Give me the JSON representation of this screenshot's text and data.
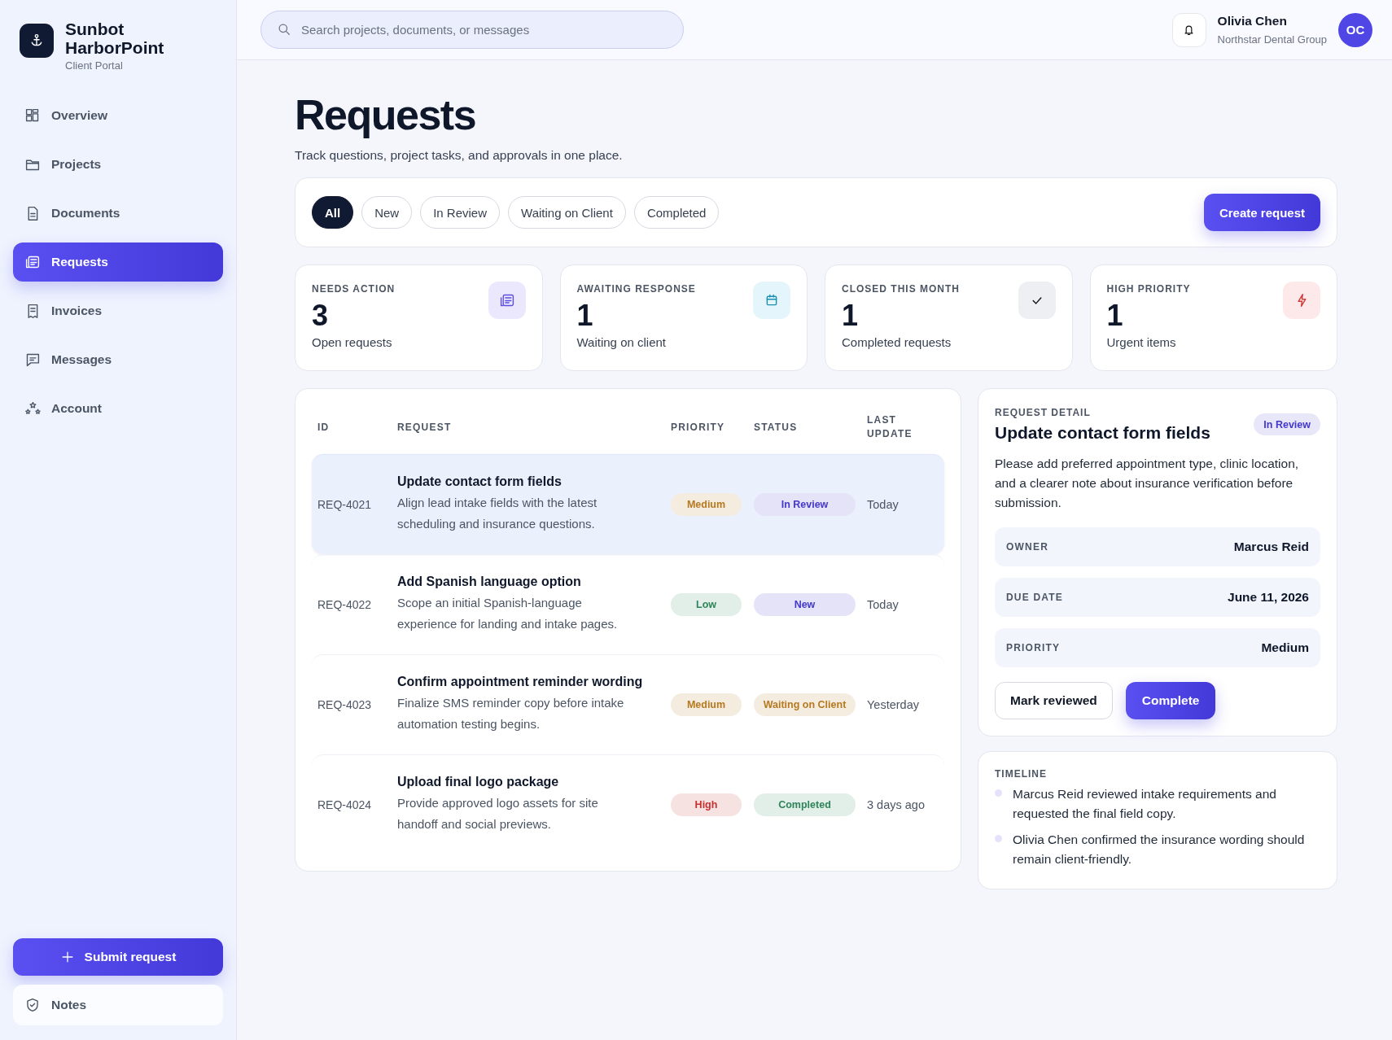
{
  "brand": {
    "name": "Sunbot HarborPoint",
    "subtitle": "Client Portal"
  },
  "nav": [
    {
      "label": "Overview",
      "selected": false
    },
    {
      "label": "Projects",
      "selected": false
    },
    {
      "label": "Documents",
      "selected": false
    },
    {
      "label": "Requests",
      "selected": true
    },
    {
      "label": "Invoices",
      "selected": false
    },
    {
      "label": "Messages",
      "selected": false
    },
    {
      "label": "Account",
      "selected": false
    }
  ],
  "sidebar_footer": {
    "submit_button": "Submit request",
    "notes": "Notes"
  },
  "search": {
    "placeholder": "Search projects, documents, or messages"
  },
  "user": {
    "name": "Olivia Chen",
    "organization": "Northstar Dental Group",
    "initials": "OC"
  },
  "page": {
    "title": "Requests",
    "subtitle": "Track questions, project tasks, and approvals in one place."
  },
  "filters": [
    {
      "label": "All",
      "selected": true
    },
    {
      "label": "New",
      "selected": false
    },
    {
      "label": "In Review",
      "selected": false
    },
    {
      "label": "Waiting on Client",
      "selected": false
    },
    {
      "label": "Completed",
      "selected": false
    }
  ],
  "create_button": "Create request",
  "stats": [
    {
      "label": "NEEDS ACTION",
      "value": "3",
      "caption": "Open requests"
    },
    {
      "label": "AWAITING RESPONSE",
      "value": "1",
      "caption": "Waiting on client"
    },
    {
      "label": "CLOSED THIS MONTH",
      "value": "1",
      "caption": "Completed requests"
    },
    {
      "label": "HIGH PRIORITY",
      "value": "1",
      "caption": "Urgent items"
    }
  ],
  "table": {
    "columns": [
      "ID",
      "REQUEST",
      "PRIORITY",
      "STATUS",
      "LAST UPDATE"
    ],
    "rows": [
      {
        "id": "REQ-4021",
        "title": "Update contact form fields",
        "description": "Align lead intake fields with the latest scheduling and insurance questions.",
        "priority": {
          "text": "Medium",
          "color": "#b7791f"
        },
        "status": {
          "text": "In Review",
          "color": "#4338ca"
        },
        "updated": "Today",
        "selected": true
      },
      {
        "id": "REQ-4022",
        "title": "Add Spanish language option",
        "description": "Scope an initial Spanish-language experience for landing and intake pages.",
        "priority": {
          "text": "Low",
          "color": "#2f855a"
        },
        "status": {
          "text": "New",
          "color": "#4338ca"
        },
        "updated": "Today",
        "selected": false
      },
      {
        "id": "REQ-4023",
        "title": "Confirm appointment reminder wording",
        "description": "Finalize SMS reminder copy before intake automation testing begins.",
        "priority": {
          "text": "Medium",
          "color": "#b7791f"
        },
        "status": {
          "text": "Waiting on Client",
          "color": "#b7791f"
        },
        "updated": "Yesterday",
        "selected": false
      },
      {
        "id": "REQ-4024",
        "title": "Upload final logo package",
        "description": "Provide approved logo assets for site handoff and social previews.",
        "priority": {
          "text": "High",
          "color": "#c53030"
        },
        "status": {
          "text": "Completed",
          "color": "#2f855a"
        },
        "updated": "3 days ago",
        "selected": false
      }
    ]
  },
  "detail": {
    "eyebrow": "REQUEST DETAIL",
    "title": "Update contact form fields",
    "status": {
      "text": "In Review",
      "color": "#4338ca"
    },
    "description": "Please add preferred appointment type, clinic location, and a clearer note about insurance verification before submission.",
    "fields": [
      {
        "label": "OWNER",
        "value": "Marcus Reid"
      },
      {
        "label": "DUE DATE",
        "value": "June 11, 2026"
      },
      {
        "label": "PRIORITY",
        "value": "Medium"
      }
    ],
    "buttons": [
      {
        "label": "Mark reviewed",
        "kind": "secondary"
      },
      {
        "label": "Complete",
        "kind": "primary"
      }
    ]
  },
  "timeline": {
    "title": "TIMELINE",
    "entries": [
      "Marcus Reid reviewed intake requirements and requested the final field copy.",
      "Olivia Chen confirmed the insurance wording should remain client-friendly."
    ]
  }
}
